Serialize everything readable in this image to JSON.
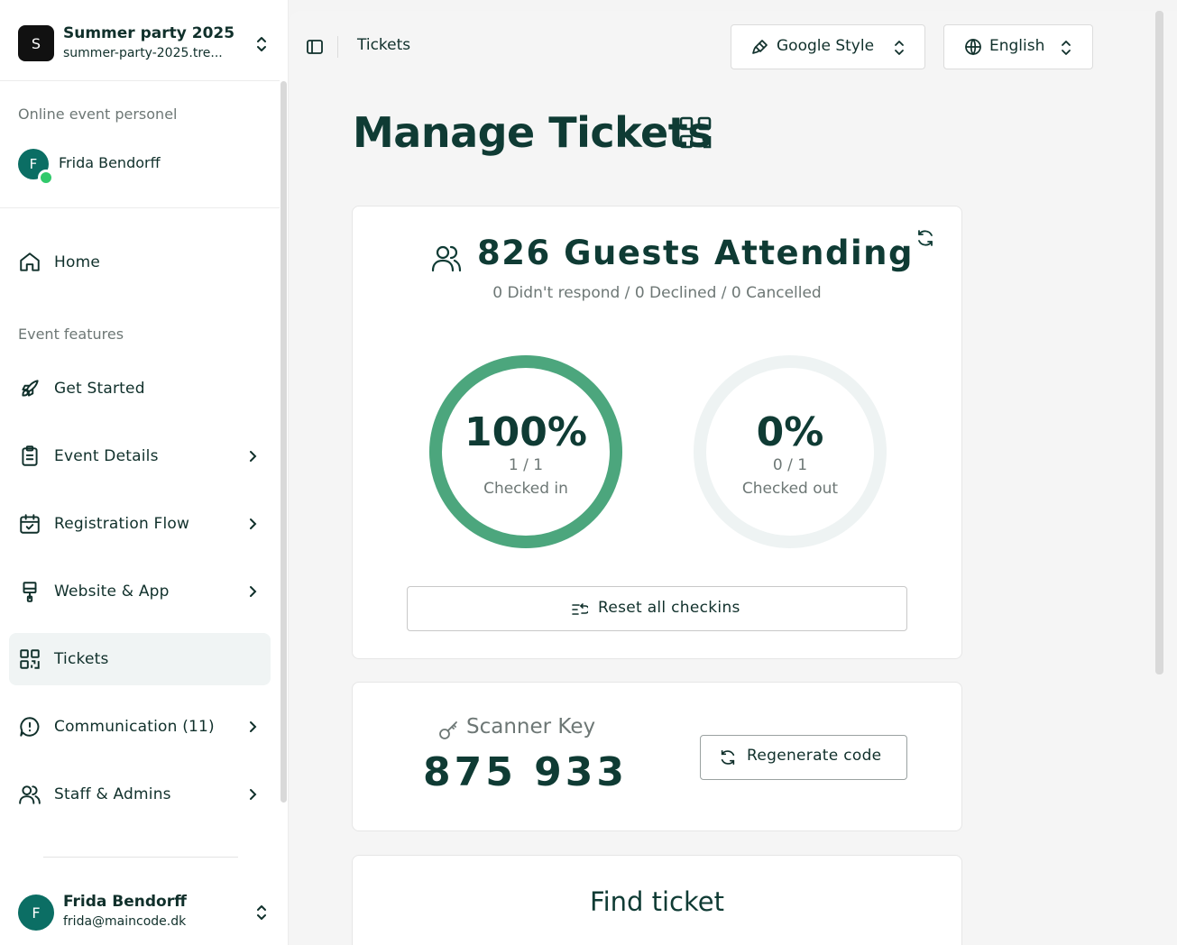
{
  "org": {
    "logo_letter": "S",
    "name": "Summer party 2025",
    "domain": "summer-party-2025.tre..."
  },
  "online": {
    "title": "Online event personel",
    "user_initial": "F",
    "user_name": "Frida Bendorff"
  },
  "nav": {
    "home": "Home",
    "section_title": "Event features",
    "items": [
      {
        "label": "Get Started",
        "icon": "rocket-icon"
      },
      {
        "label": "Event Details",
        "icon": "clipboard-icon"
      },
      {
        "label": "Registration Flow",
        "icon": "calendar-check-icon"
      },
      {
        "label": "Website & App",
        "icon": "paintbrush-icon"
      },
      {
        "label": "Tickets",
        "icon": "qr-code-icon",
        "active": true
      },
      {
        "label": "Communication (11)",
        "icon": "message-alert-icon"
      },
      {
        "label": "Staff & Admins",
        "icon": "users-icon"
      }
    ]
  },
  "user": {
    "initial": "F",
    "name": "Frida Bendorff",
    "email": "frida@maincode.dk"
  },
  "topbar": {
    "breadcrumb": "Tickets",
    "style_select": "Google Style",
    "language_select": "English"
  },
  "page": {
    "title": "Manage Tickets"
  },
  "attendance": {
    "headline": "826 Guests Attending",
    "subline": "0 Didn't respond / 0 Declined / 0 Cancelled",
    "checked_in": {
      "percent_label": "100%",
      "fraction": "1 / 1",
      "label": "Checked in",
      "value": 1.0
    },
    "checked_out": {
      "percent_label": "0%",
      "fraction": "0 / 1",
      "label": "Checked out",
      "value": 0.0
    },
    "reset_button": "Reset all checkins"
  },
  "scanner": {
    "title": "Scanner Key",
    "code": "875 933",
    "regenerate_button": "Regenerate code"
  },
  "find": {
    "title": "Find ticket"
  },
  "colors": {
    "ring_fill": "#4ca67d",
    "ring_track": "#eef3f3",
    "brand_dark": "#0f3b34",
    "online_dot": "#31c96b",
    "avatar": "#0b6e64"
  }
}
